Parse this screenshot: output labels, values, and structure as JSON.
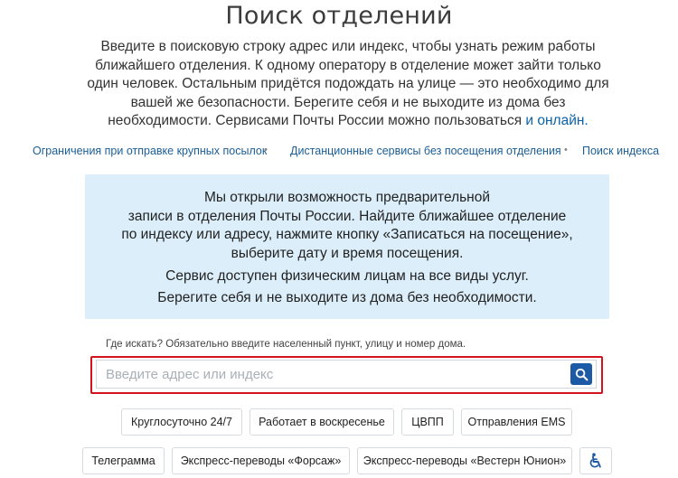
{
  "page": {
    "title": "Поиск отделений",
    "intro_lines": [
      "Введите в поисковую строку адрес или индекс, чтобы узнать режим работы",
      "ближайшего отделения. К одному оператору в отделение может зайти только",
      "один человек. Остальным придётся подождать на улице — это необходимо для",
      "вашей же безопасности. Берегите себя и не выходите из дома без",
      "необходимости. Сервисами Почты России можно пользоваться"
    ],
    "intro_link": "и онлайн.",
    "link_color": "#0b62a8"
  },
  "quick_links": [
    "Ограничения при отправке крупных посылок",
    "Дистанционные сервисы без посещения отделения",
    "Поиск индекса"
  ],
  "notice": {
    "lines": [
      "Мы открыли возможность предварительной",
      "записи в отделения Почты России. Найдите ближайшее отделение",
      "по индексу или адресу, нажмите кнопку «Записаться на посещение»,",
      "выберите дату и время посещения."
    ],
    "line2": "Сервис доступен физическим лицам на все виды услуг.",
    "line3": "Берегите себя и не выходите из дома без необходимости.",
    "background": "#dbeefa"
  },
  "search": {
    "hint": "Где искать? Обязательно введите населенный пункт, улицу и номер дома.",
    "value": "",
    "placeholder": "Введите адрес или индекс",
    "button_icon": "search-icon",
    "button_color": "#1c5aa6",
    "highlight_color": "#d3141e"
  },
  "filters": {
    "row1": [
      "Круглосуточно 24/7",
      "Работает в воскресенье",
      "ЦВПП",
      "Отправления EMS"
    ],
    "row2": [
      "Телеграмма",
      "Экспресс-переводы «Форсаж»",
      "Экспресс-переводы «Вестерн Юнион»"
    ],
    "accessibility_icon": "wheelchair-icon"
  }
}
